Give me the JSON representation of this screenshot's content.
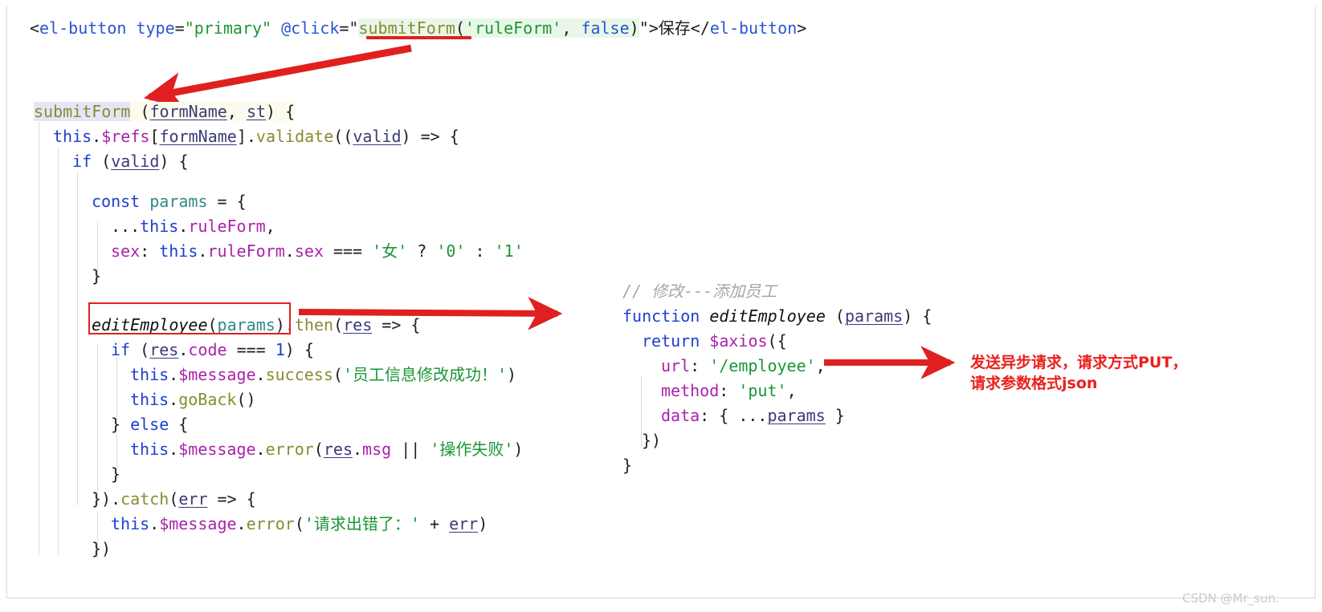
{
  "document": {
    "title": "Vue submitForm / editEmployee code annotation",
    "watermark": "CSDN @Mr_sun."
  },
  "template_line": {
    "t1": "<",
    "t2": "el-button",
    "t3": " ",
    "t4": "type",
    "t5": "=",
    "t6": "\"primary\"",
    "t7": " ",
    "t8": "@click",
    "t9": "=",
    "t10": "\"",
    "t11": "submitForm",
    "t12": "(",
    "t13": "'ruleForm'",
    "t14": ", ",
    "t15": "false",
    "t16": ")",
    "t17": "\"",
    "t18": ">",
    "t19": "保存",
    "t20": "</",
    "t21": "el-button",
    "t22": ">"
  },
  "left_code": {
    "l1": {
      "a": "submitForm",
      "b": " (",
      "c": "formName",
      "d": ", ",
      "e": "st",
      "f": ") {"
    },
    "l2": {
      "a": "this",
      "b": ".",
      "c": "$refs",
      "d": "[",
      "e": "formName",
      "f": "].",
      "g": "validate",
      "h": "((",
      "i": "valid",
      "j": ") => {"
    },
    "l3": {
      "a": "if",
      "b": " (",
      "c": "valid",
      "d": ") {"
    },
    "l4": {
      "a": "const",
      "b": " ",
      "c": "params",
      "d": " = {"
    },
    "l5": {
      "a": "...",
      "b": "this",
      "c": ".",
      "d": "ruleForm",
      "e": ","
    },
    "l6": {
      "a": "sex",
      "b": ": ",
      "c": "this",
      "d": ".",
      "e": "ruleForm",
      "f": ".",
      "g": "sex",
      "h": " === ",
      "i": "'女'",
      "j": " ? ",
      "k": "'0'",
      "l": " : ",
      "m": "'1'"
    },
    "l7": {
      "a": "}"
    },
    "l8": {
      "a": "editEmployee",
      "b": "(",
      "c": "params",
      "d": ").",
      "e": "then",
      "f": "(",
      "g": "res",
      "h": " => {"
    },
    "l9": {
      "a": "if",
      "b": " (",
      "c": "res",
      "d": ".",
      "e": "code",
      "f": " === ",
      "g": "1",
      "h": ") {"
    },
    "l10": {
      "a": "this",
      "b": ".",
      "c": "$message",
      "d": ".",
      "e": "success",
      "f": "(",
      "g": "'员工信息修改成功！'",
      "h": ")"
    },
    "l11": {
      "a": "this",
      "b": ".",
      "c": "goBack",
      "d": "()"
    },
    "l12": {
      "a": "} ",
      "b": "else",
      "c": " {"
    },
    "l13": {
      "a": "this",
      "b": ".",
      "c": "$message",
      "d": ".",
      "e": "error",
      "f": "(",
      "g": "res",
      "h": ".",
      "i": "msg",
      "j": " || ",
      "k": "'操作失败'",
      "l": ")"
    },
    "l14": {
      "a": "}"
    },
    "l15": {
      "a": "}).",
      "b": "catch",
      "c": "(",
      "d": "err",
      "e": " => {"
    },
    "l16": {
      "a": "this",
      "b": ".",
      "c": "$message",
      "d": ".",
      "e": "error",
      "f": "(",
      "g": "'请求出错了：'",
      "h": " + ",
      "i": "err",
      "j": ")"
    },
    "l17": {
      "a": "})"
    }
  },
  "right_code": {
    "r1": {
      "a": "// 修改---添加员工"
    },
    "r2": {
      "a": "function",
      "b": " ",
      "c": "editEmployee",
      "d": " (",
      "e": "params",
      "f": ") {"
    },
    "r3": {
      "a": "return",
      "b": " ",
      "c": "$axios",
      "d": "({"
    },
    "r4": {
      "a": "url",
      "b": ": ",
      "c": "'/employee'",
      "d": ","
    },
    "r5": {
      "a": "method",
      "b": ": ",
      "c": "'put'",
      "d": ","
    },
    "r6": {
      "a": "data",
      "b": ": { ...",
      "c": "params",
      "d": " }"
    },
    "r7": {
      "a": "})"
    },
    "r8": {
      "a": "}"
    }
  },
  "annotations": {
    "note_line1": "发送异步请求，请求方式PUT，",
    "note_line2": "请求参数格式json"
  },
  "colors": {
    "annotation_red": "#e8211c",
    "arrow_red": "#e02020",
    "string_green": "#1a9636",
    "keyword_blue": "#1c3fcf",
    "property_magenta": "#aa22aa",
    "function_olive": "#8a8a30",
    "comment_gray": "#a6a6a6",
    "highlight_green": "#e8f7e8",
    "highlight_cream": "#fdfbee",
    "highlight_lavender": "#e7e4f5"
  }
}
